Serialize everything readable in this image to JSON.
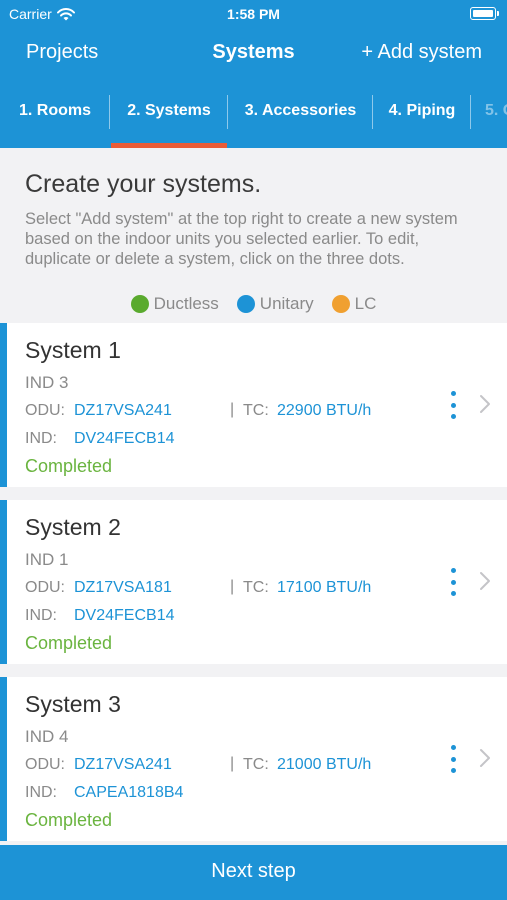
{
  "status_bar": {
    "carrier": "Carrier",
    "time": "1:58 PM"
  },
  "nav": {
    "back_label": "Projects",
    "title": "Systems",
    "add_label": "+ Add system"
  },
  "tabs": [
    {
      "label": "1.  Rooms"
    },
    {
      "label": "2. Systems"
    },
    {
      "label": "3. Accessories"
    },
    {
      "label": "4. Piping"
    },
    {
      "label": "5. O"
    }
  ],
  "intro": {
    "title": "Create your systems.",
    "text": "Select \"Add system\" at the top right to create a new system based on the indoor units you selected earlier. To edit, duplicate or delete a system, click on the three dots.",
    "legend": [
      {
        "label": "Ductless",
        "color": "#5aaa2e"
      },
      {
        "label": "Unitary",
        "color": "#1d93d6"
      },
      {
        "label": "LC",
        "color": "#f0a030"
      }
    ]
  },
  "labels": {
    "odu": "ODU:",
    "tc": "TC:",
    "ind": "IND:",
    "separator": "|"
  },
  "systems": [
    {
      "title": "System 1",
      "ind_count": "IND 3",
      "odu": "DZ17VSA241",
      "tc": "22900 BTU/h",
      "ind": "DV24FECB14",
      "status": "Completed"
    },
    {
      "title": "System 2",
      "ind_count": "IND 1",
      "odu": "DZ17VSA181",
      "tc": "17100 BTU/h",
      "ind": "DV24FECB14",
      "status": "Completed"
    },
    {
      "title": "System 3",
      "ind_count": "IND 4",
      "odu": "DZ17VSA241",
      "tc": "21000 BTU/h",
      "ind": "CAPEA1818B4",
      "status": "Completed"
    }
  ],
  "footer": {
    "next_label": "Next step"
  },
  "colors": {
    "brand_blue": "#1d93d6",
    "active_tab_indicator": "#e95c37",
    "status_completed": "#6ab43f"
  }
}
